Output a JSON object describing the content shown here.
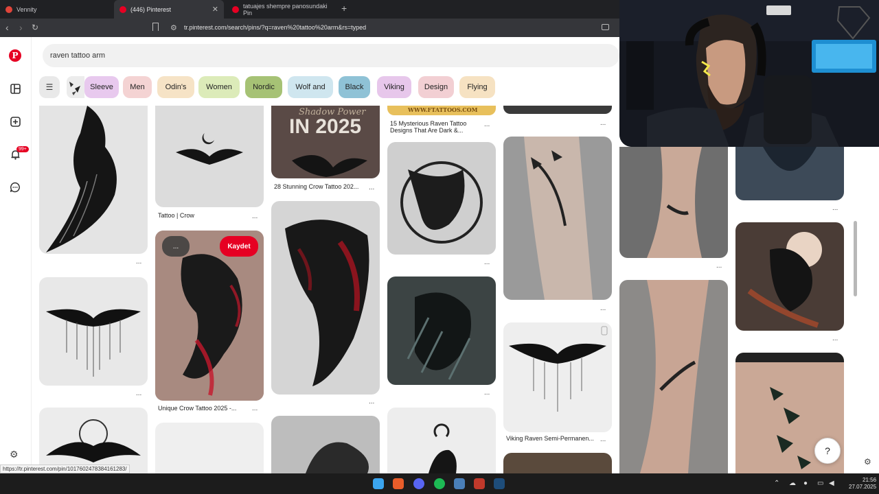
{
  "browser": {
    "tabs": [
      {
        "label": "Vennity",
        "favicon_color": "#e0453a"
      },
      {
        "label": "(446) Pinterest",
        "favicon_color": "#e60023"
      },
      {
        "label": "tatuajes shempre panosundaki Pin",
        "favicon_color": "#e60023"
      }
    ],
    "close_symbol": "✕",
    "new_tab_symbol": "+",
    "url": "tr.pinterest.com/search/pins/?q=raven%20tattoo%20arm&rs=typed",
    "status_url": "https://tr.pinterest.com/pin/1017602478384161283/"
  },
  "search": {
    "value": "raven tattoo arm"
  },
  "chips": [
    {
      "label": "Sleeve",
      "color": "#e8c9ee"
    },
    {
      "label": "Men",
      "color": "#f4d3d3"
    },
    {
      "label": "Odin's",
      "color": "#f6e3c6"
    },
    {
      "label": "Women",
      "color": "#dcebb9"
    },
    {
      "label": "Nordic",
      "color": "#a6c275"
    },
    {
      "label": "Wolf and",
      "color": "#cfe6ef"
    },
    {
      "label": "Black",
      "color": "#8fc2d6"
    },
    {
      "label": "Viking",
      "color": "#e7c7eb"
    },
    {
      "label": "Design",
      "color": "#f2cfd3"
    },
    {
      "label": "Flying",
      "color": "#f6e2c2"
    }
  ],
  "pins": {
    "crow_title": "Tattoo | Crow",
    "stunning_title": "28 Stunning Crow Tattoo 202...",
    "mysterious_title_1": "15 Mysterious Raven Tattoo",
    "mysterious_title_2": "Designs That Are Dark &...",
    "unique_title": "Unique Crow Tattoo 2025 -...",
    "viking_title": "Viking Raven Semi-Permanen...",
    "in2025_text": "IN 2025",
    "shadow_text": "Shadow Power",
    "ftattoos_text": "WWW.FTATTOOS.COM",
    "save_label": "Kaydet",
    "more_label": "...",
    "dots": "..."
  },
  "notifications_badge": "99+",
  "help_symbol": "?",
  "taskbar": {
    "time": "21:56",
    "date": "27.07.2025"
  }
}
